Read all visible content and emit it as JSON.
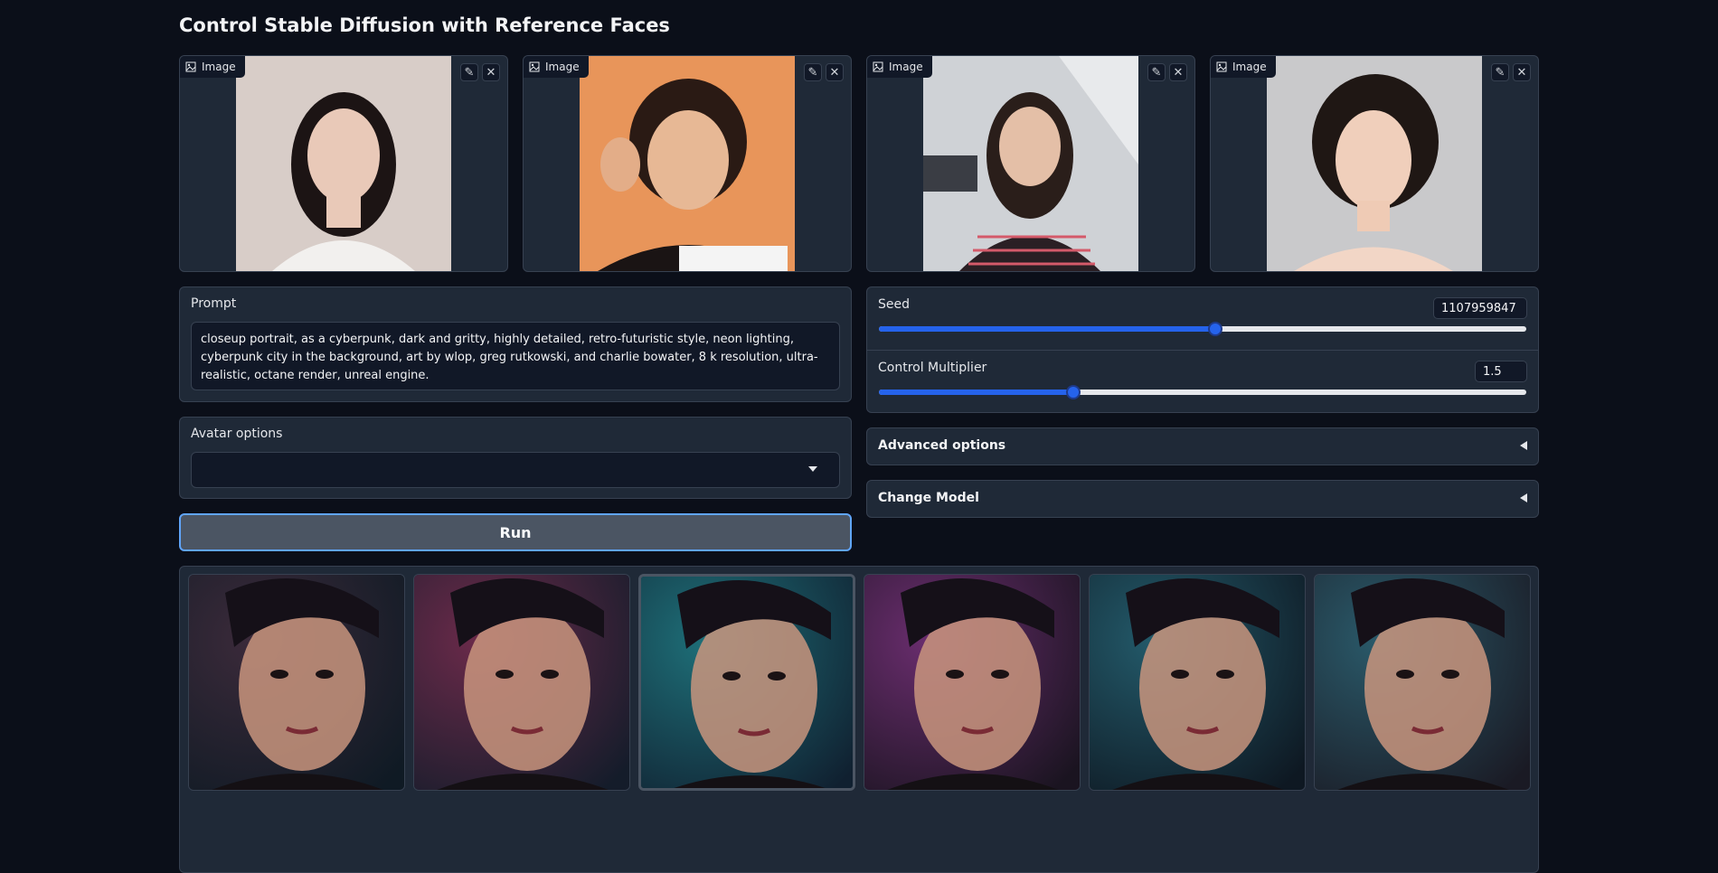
{
  "app": {
    "title": "Control Stable Diffusion with Reference Faces"
  },
  "image_inputs": [
    {
      "label": "Image",
      "edit_icon": "pencil-icon",
      "clear_icon": "close-icon",
      "bg": "#d8cdc8"
    },
    {
      "label": "Image",
      "edit_icon": "pencil-icon",
      "clear_icon": "close-icon",
      "bg": "#e8955a"
    },
    {
      "label": "Image",
      "edit_icon": "pencil-icon",
      "clear_icon": "close-icon",
      "bg": "#cfd2d6"
    },
    {
      "label": "Image",
      "edit_icon": "pencil-icon",
      "clear_icon": "close-icon",
      "bg": "#c9c9cb"
    }
  ],
  "prompt": {
    "label": "Prompt",
    "value": "closeup portrait, as a cyberpunk, dark and gritty, highly detailed, retro-futuristic style, neon lighting, cyberpunk city in the background, art by wlop, greg rutkowski, and charlie bowater, 8 k resolution, ultra-realistic, octane render, unreal engine."
  },
  "avatar_options": {
    "label": "Avatar options",
    "selected": ""
  },
  "run_button": {
    "label": "Run"
  },
  "seed": {
    "label": "Seed",
    "value": "1107959847",
    "fraction": 0.52
  },
  "control_multiplier": {
    "label": "Control Multiplier",
    "value": "1.5",
    "fraction": 0.3
  },
  "advanced_options": {
    "label": "Advanced options"
  },
  "change_model": {
    "label": "Change Model"
  },
  "gallery": {
    "selected_index": 2,
    "items": [
      {
        "tone_a": "#3b2a3a",
        "tone_b": "#0f1a24"
      },
      {
        "tone_a": "#6b2a4a",
        "tone_b": "#141c2a"
      },
      {
        "tone_a": "#1e6f78",
        "tone_b": "#102030"
      },
      {
        "tone_a": "#6a2d6e",
        "tone_b": "#1a1420"
      },
      {
        "tone_a": "#235a6a",
        "tone_b": "#0e1822"
      },
      {
        "tone_a": "#2a5a6a",
        "tone_b": "#1a1a24"
      }
    ]
  }
}
